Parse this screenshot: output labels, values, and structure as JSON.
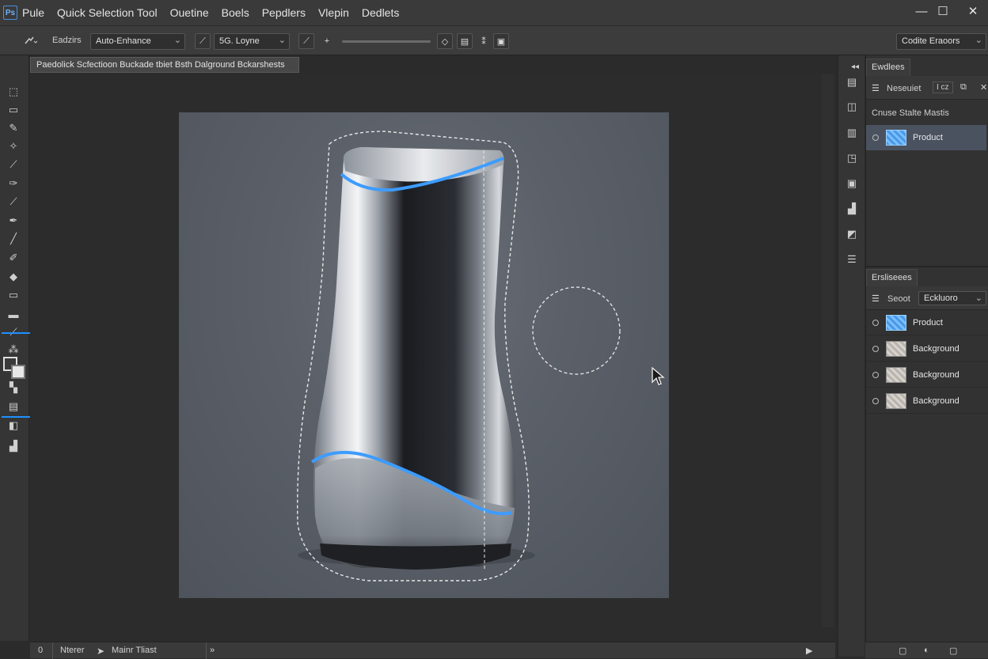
{
  "menubar": {
    "logo": "Ps",
    "items": [
      "Pule",
      "Quick Selection Tool",
      "Ouetine",
      "Boels",
      "Pepdlers",
      "Vlepin",
      "Dedlets"
    ],
    "window_controls": [
      "—",
      "☐",
      "✕"
    ]
  },
  "options": {
    "tool_label": "Eadzirs",
    "mode_select": "Auto-Enhance",
    "layer_select": "5G. Loyne",
    "workspace_select": "Codite Eraoors"
  },
  "document": {
    "tab_title": "Paedolick Scfectioon Buckade tbiet Bsth Dalground Bckarshests"
  },
  "toolbar": {
    "tools": [
      "move-icon",
      "marquee-icon",
      "lasso-icon",
      "quick-selection-icon",
      "crop-icon",
      "eyedropper-icon",
      "brush-icon",
      "clone-stamp-icon",
      "history-brush-icon",
      "eraser-icon",
      "gradient-icon",
      "dodge-icon",
      "pen-icon",
      "type-icon",
      "path-selection-icon",
      "shape-icon",
      "hand-icon",
      "zoom-icon"
    ]
  },
  "panels": {
    "top_tab": "Ewdlees",
    "top_row_label": "Neseuiet",
    "top_row_value": "I cz",
    "channels_label": "Cnuse  Stalte Mastis",
    "channel_layer": "Product",
    "layers_tab": "Ersliseees",
    "layers_mode_label": "Seoot",
    "layers_mode_select": "Eckluoro",
    "layers": [
      {
        "name": "Product",
        "thumb": "blue"
      },
      {
        "name": "Background",
        "thumb": "grey"
      },
      {
        "name": "Background",
        "thumb": "grey"
      },
      {
        "name": "Background",
        "thumb": "grey"
      }
    ]
  },
  "status": {
    "zoom": "0",
    "left_label": "Nterer",
    "tool_label": "Mainr Tliast",
    "arrow": "»"
  },
  "colors": {
    "accent": "#1e90ff",
    "selection_stroke": "#3d9cff"
  }
}
